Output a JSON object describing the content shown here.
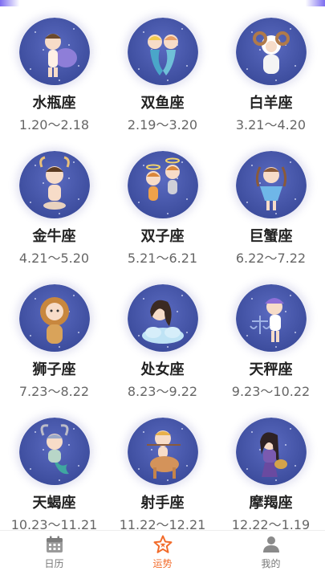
{
  "zodiac": [
    {
      "name": "水瓶座",
      "date": "1.20～2.18",
      "icon": "aquarius-avatar-icon"
    },
    {
      "name": "双鱼座",
      "date": "2.19～3.20",
      "icon": "pisces-avatar-icon"
    },
    {
      "name": "白羊座",
      "date": "3.21～4.20",
      "icon": "aries-avatar-icon"
    },
    {
      "name": "金牛座",
      "date": "4.21～5.20",
      "icon": "taurus-avatar-icon"
    },
    {
      "name": "双子座",
      "date": "5.21～6.21",
      "icon": "gemini-avatar-icon"
    },
    {
      "name": "巨蟹座",
      "date": "6.22～7.22",
      "icon": "cancer-avatar-icon"
    },
    {
      "name": "狮子座",
      "date": "7.23～8.22",
      "icon": "leo-avatar-icon"
    },
    {
      "name": "处女座",
      "date": "8.23～9.22",
      "icon": "virgo-avatar-icon"
    },
    {
      "name": "天秤座",
      "date": "9.23～10.22",
      "icon": "libra-avatar-icon"
    },
    {
      "name": "天蝎座",
      "date": "10.23～11.21",
      "icon": "scorpio-avatar-icon"
    },
    {
      "name": "射手座",
      "date": "11.22～12.21",
      "icon": "sagittarius-avatar-icon"
    },
    {
      "name": "摩羯座",
      "date": "12.22～1.19",
      "icon": "capricorn-avatar-icon"
    }
  ],
  "tabs": [
    {
      "label": "日历",
      "icon": "calendar-icon",
      "active": false
    },
    {
      "label": "运势",
      "icon": "star-fortune-icon",
      "active": true
    },
    {
      "label": "我的",
      "icon": "person-icon",
      "active": false
    }
  ],
  "colors": {
    "accent": "#f26b2a",
    "avatar_bg": "#3a4a9a",
    "tab_inactive": "#777777"
  }
}
